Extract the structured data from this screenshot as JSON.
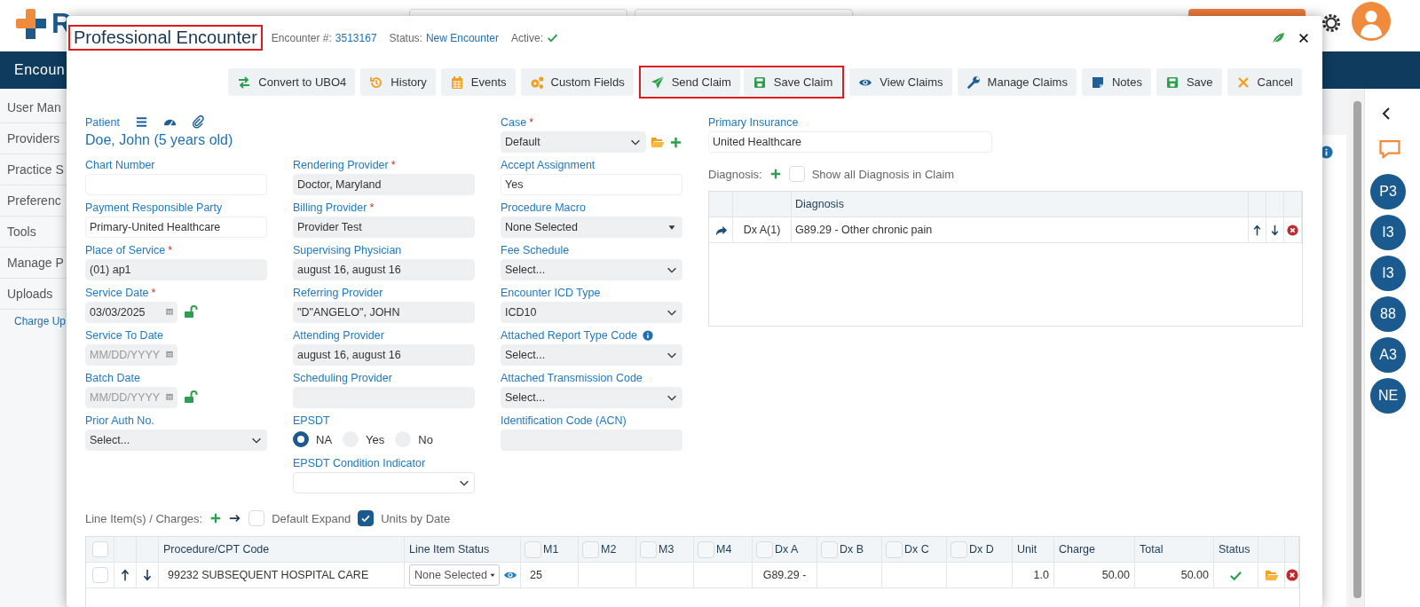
{
  "app": {
    "logo_text": "R",
    "nav_title": "Encoun",
    "sidebar": [
      {
        "label": "User Man",
        "kind": "item"
      },
      {
        "label": "Providers",
        "kind": "item"
      },
      {
        "label": "Practice S",
        "kind": "item"
      },
      {
        "label": "Preferenc",
        "kind": "item"
      },
      {
        "label": "Tools",
        "kind": "item"
      },
      {
        "label": "Manage P",
        "kind": "item"
      },
      {
        "label": "Uploads",
        "kind": "item"
      },
      {
        "label": "Charge Up",
        "kind": "subitem"
      }
    ],
    "rail_badges": [
      "P3",
      "I3",
      "I3",
      "88",
      "A3",
      "NE"
    ]
  },
  "modal": {
    "title": "Professional Encounter",
    "title_highlighted": true,
    "meta": [
      {
        "label": "Encounter #:",
        "value": "3513167"
      },
      {
        "label": "Status:",
        "value": "New Encounter"
      }
    ],
    "active_label": "Active:",
    "active": true,
    "toolbar": [
      {
        "label": "Convert to UBO4",
        "kind": "convert",
        "highlighted": false
      },
      {
        "label": "History",
        "kind": "history",
        "highlighted": false
      },
      {
        "label": "Events",
        "kind": "events",
        "highlighted": false
      },
      {
        "label": "Custom Fields",
        "kind": "custom",
        "highlighted": false
      },
      {
        "label": "Send Claim",
        "kind": "send",
        "highlighted": true
      },
      {
        "label": "Save Claim",
        "kind": "save",
        "highlighted": true
      },
      {
        "label": "View Claims",
        "kind": "view",
        "highlighted": false
      },
      {
        "label": "Manage Claims",
        "kind": "manage",
        "highlighted": false
      },
      {
        "label": "Notes",
        "kind": "notes",
        "highlighted": false
      },
      {
        "label": "Save",
        "kind": "save",
        "highlighted": false
      },
      {
        "label": "Cancel",
        "kind": "cancel",
        "highlighted": false
      }
    ],
    "form": {
      "columns": [
        [
          {
            "kind": "patient",
            "label": "Patient",
            "value": "Doe, John (5 years old)"
          },
          {
            "kind": "text",
            "label": "Chart Number",
            "readonly": false
          },
          {
            "kind": "text",
            "label": "Payment Responsible Party",
            "value": "Primary-United Healthcare",
            "readonly": false
          },
          {
            "kind": "text",
            "label": "Place of Service",
            "required_mark": "*",
            "value": "(01) ap1",
            "readonly": true
          },
          {
            "kind": "date",
            "label": "Service Date",
            "required_mark": "*",
            "value": "03/03/2025",
            "lock": true
          },
          {
            "kind": "date",
            "label": "Service To Date",
            "placeholder": "MM/DD/YYYY",
            "lock": false
          },
          {
            "kind": "date",
            "label": "Batch Date",
            "placeholder": "MM/DD/YYYY",
            "lock": true
          },
          {
            "kind": "select",
            "label": "Prior Auth No.",
            "value": "Select..."
          }
        ],
        [
          {
            "kind": "text",
            "label": "Rendering Provider",
            "required_mark": "*",
            "value": "Doctor, Maryland",
            "readonly": true
          },
          {
            "kind": "text",
            "label": "Billing Provider",
            "required_mark": "*",
            "value": "Provider Test",
            "readonly": true
          },
          {
            "kind": "text",
            "label": "Supervising Physician",
            "value": "august 16, august 16",
            "readonly": true
          },
          {
            "kind": "text",
            "label": "Referring Provider",
            "value": "\"D\"ANGELO\", JOHN",
            "readonly": true
          },
          {
            "kind": "text",
            "label": "Attending Provider",
            "value": "august 16, august 16",
            "readonly": true
          },
          {
            "kind": "text",
            "label": "Scheduling Provider",
            "readonly": true
          },
          {
            "kind": "radio",
            "label": "EPSDT",
            "options": [
              {
                "label": "NA",
                "selected": true
              },
              {
                "label": "Yes",
                "selected": false
              },
              {
                "label": "No",
                "selected": false
              }
            ]
          },
          {
            "kind": "select",
            "label": "EPSDT Condition Indicator",
            "outlined": true
          }
        ],
        [
          {
            "kind": "select",
            "label": "Case",
            "required_mark": "*",
            "value": "Default",
            "actions": true
          },
          {
            "kind": "text",
            "label": "Accept Assignment",
            "value": "Yes",
            "readonly": false
          },
          {
            "kind": "dropdown",
            "label": "Procedure Macro",
            "value": "None Selected"
          },
          {
            "kind": "select",
            "label": "Fee Schedule",
            "value": "Select..."
          },
          {
            "kind": "select",
            "label": "Encounter ICD Type",
            "value": "ICD10"
          },
          {
            "kind": "select",
            "label": "Attached Report Type Code",
            "value": "Select...",
            "info": true
          },
          {
            "kind": "select",
            "label": "Attached Transmission Code",
            "value": "Select..."
          },
          {
            "kind": "text",
            "label": "Identification Code (ACN)",
            "readonly": true
          }
        ]
      ]
    },
    "primary_insurance": {
      "label": "Primary Insurance",
      "value": "United Healthcare"
    },
    "diagnosis": {
      "label": "Diagnosis:",
      "show_all_label": "Show all Diagnosis in Claim",
      "show_all_checked": false,
      "heading": "Diagnosis",
      "rows": [
        {
          "code": "Dx A(1)",
          "description": "G89.29 - Other chronic pain"
        }
      ]
    },
    "line_items": {
      "label": "Line Item(s) / Charges:",
      "options": [
        {
          "label": "Default Expand",
          "checked": false
        },
        {
          "label": "Units by Date",
          "checked": true
        }
      ],
      "select_all_checked": false,
      "columns": [
        {
          "label": "Procedure/CPT Code"
        },
        {
          "label": "Line Item Status"
        },
        {
          "label": "M1",
          "checked": false
        },
        {
          "label": "M2",
          "checked": false
        },
        {
          "label": "M3",
          "checked": false
        },
        {
          "label": "M4",
          "checked": false
        },
        {
          "label": "Dx A",
          "checked": false
        },
        {
          "label": "Dx B",
          "checked": false
        },
        {
          "label": "Dx C",
          "checked": false
        },
        {
          "label": "Dx D",
          "checked": false
        },
        {
          "label": "Unit"
        },
        {
          "label": "Charge"
        },
        {
          "label": "Total"
        },
        {
          "label": "Status"
        }
      ],
      "rows": [
        {
          "checked": false,
          "procedure": "99232 SUBSEQUENT HOSPITAL CARE",
          "line_item_status": "None Selected",
          "m1": "25",
          "dx_a": "G89.29 -",
          "unit": "1.0",
          "charge": "50.00",
          "total": "50.00",
          "status_ok": true
        }
      ]
    }
  }
}
